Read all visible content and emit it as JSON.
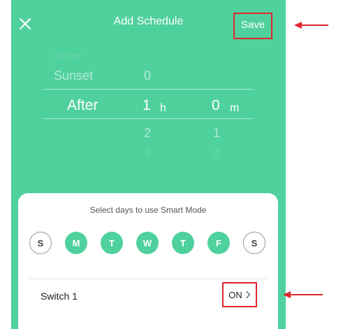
{
  "header": {
    "title": "Add Schedule",
    "save_label": "Save",
    "close_icon": "close-icon"
  },
  "picker": {
    "col1": [
      "Before",
      "Sunset",
      "After"
    ],
    "col2": [
      "0",
      "1",
      "2",
      "3"
    ],
    "col2_unit": "h",
    "col3": [
      "0",
      "1",
      "2"
    ],
    "col3_unit": "m",
    "selected": {
      "mode": "After",
      "hours": "1",
      "minutes": "0"
    }
  },
  "card": {
    "title": "Select days to use Smart Mode",
    "days": [
      {
        "label": "S",
        "active": false
      },
      {
        "label": "M",
        "active": true
      },
      {
        "label": "T",
        "active": true
      },
      {
        "label": "W",
        "active": true
      },
      {
        "label": "T",
        "active": true
      },
      {
        "label": "F",
        "active": true
      },
      {
        "label": "S",
        "active": false
      }
    ],
    "switch_label": "Switch 1",
    "switch_value": "ON",
    "chevron_icon": "chevron-right-icon"
  },
  "colors": {
    "accent": "#4fd19d",
    "highlight": "#e0262e"
  }
}
